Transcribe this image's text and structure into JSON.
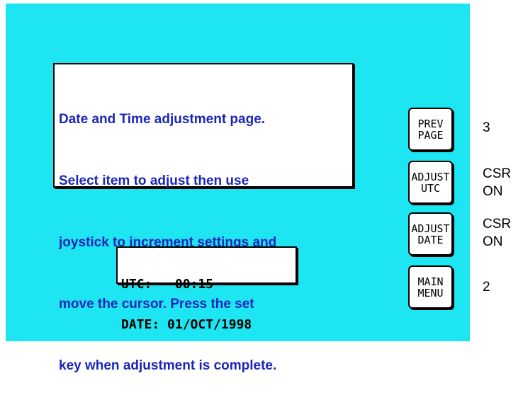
{
  "info_text": {
    "lines": [
      "Date and Time adjustment page.",
      "Select item to adjust then use",
      "joystick to increment settings and",
      "move the cursor. Press the set",
      "key when adjustment is complete."
    ]
  },
  "clock": {
    "utc_label": "UTC:",
    "utc_value": "00:15",
    "date_label": "DATE:",
    "date_value": "01/OCT/1998"
  },
  "soft_keys": [
    {
      "line1": "PREV",
      "line2": "PAGE",
      "status_line1": "3",
      "status_line2": ""
    },
    {
      "line1": "ADJUST",
      "line2": "UTC",
      "status_line1": "CSR",
      "status_line2": "ON"
    },
    {
      "line1": "ADJUST",
      "line2": "DATE",
      "status_line1": "CSR",
      "status_line2": "ON"
    },
    {
      "line1": "MAIN",
      "line2": "MENU",
      "status_line1": "2",
      "status_line2": ""
    }
  ],
  "colors": {
    "display_background": "#1ee5f2",
    "info_text": "#1b26b8",
    "panel_background": "#ffffff"
  }
}
